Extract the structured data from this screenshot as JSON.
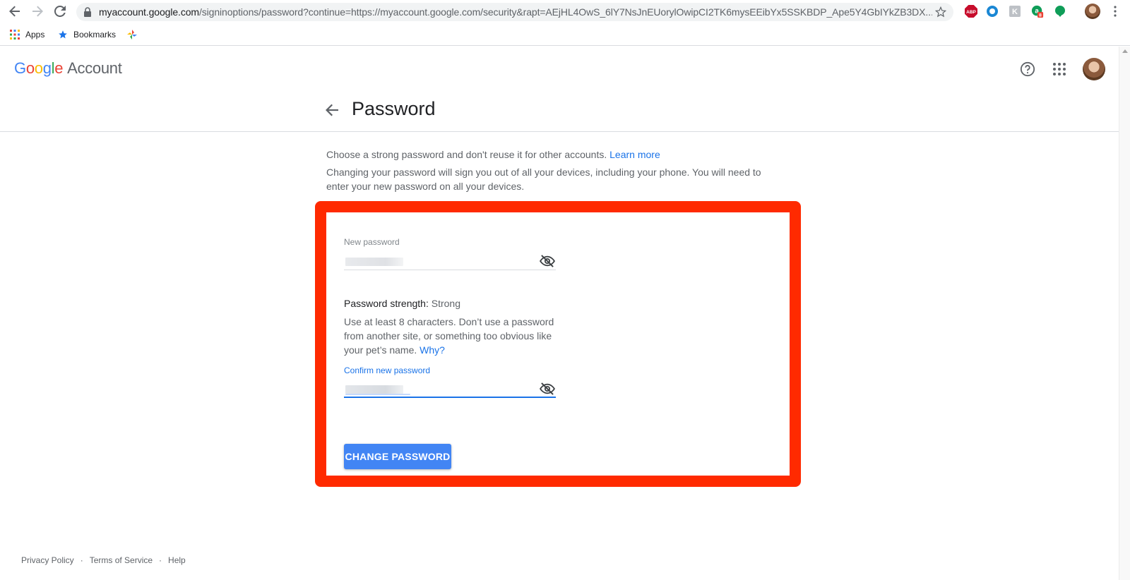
{
  "browser": {
    "url_host": "myaccount.google.com",
    "url_path": "/signinoptions/password?continue=https://myaccount.google.com/security&rapt=AEjHL4OwS_6lY7NsJnEUorylOwipCI2TK6mysEEibYx5SSKBDP_Ape5Y4GbIYkZB3DX...",
    "extensions": [
      {
        "name": "adblock-plus-icon",
        "label": "ABP",
        "color": "#c70d2c"
      },
      {
        "name": "ring-extension-icon",
        "color": "#1a87d4"
      },
      {
        "name": "gray-extension-icon",
        "label": "K",
        "color": "#9aa0a6"
      },
      {
        "name": "green-a-extension-icon",
        "label": "a",
        "badge": "8",
        "color": "#0f9d58"
      },
      {
        "name": "green-bubble-extension-icon",
        "color": "#0f9d58"
      }
    ],
    "bookmarks": {
      "apps_label": "Apps",
      "bookmarks_label": "Bookmarks"
    }
  },
  "header": {
    "logo_letters": [
      "G",
      "o",
      "o",
      "g",
      "l",
      "e"
    ],
    "logo_suffix": "Account"
  },
  "page": {
    "title": "Password",
    "intro_text": "Choose a strong password and don't reuse it for other accounts.",
    "learn_more": "Learn more",
    "intro_text_2": "Changing your password will sign you out of all your devices, including your phone. You will need to enter your new password on all your devices."
  },
  "form": {
    "new_password_label": "New password",
    "strength_label": "Password strength:",
    "strength_value": "Strong",
    "help_text": "Use at least 8 characters. Don’t use a password from another site, or something too obvious like your pet’s name.",
    "why_link": "Why?",
    "confirm_password_label": "Confirm new password",
    "submit_label": "CHANGE PASSWORD"
  },
  "footer": {
    "privacy": "Privacy Policy",
    "terms": "Terms of Service",
    "help": "Help",
    "separator": "·"
  },
  "colors": {
    "highlight_border": "#ff2a00",
    "button": "#4285f4",
    "link": "#1a73e8"
  }
}
